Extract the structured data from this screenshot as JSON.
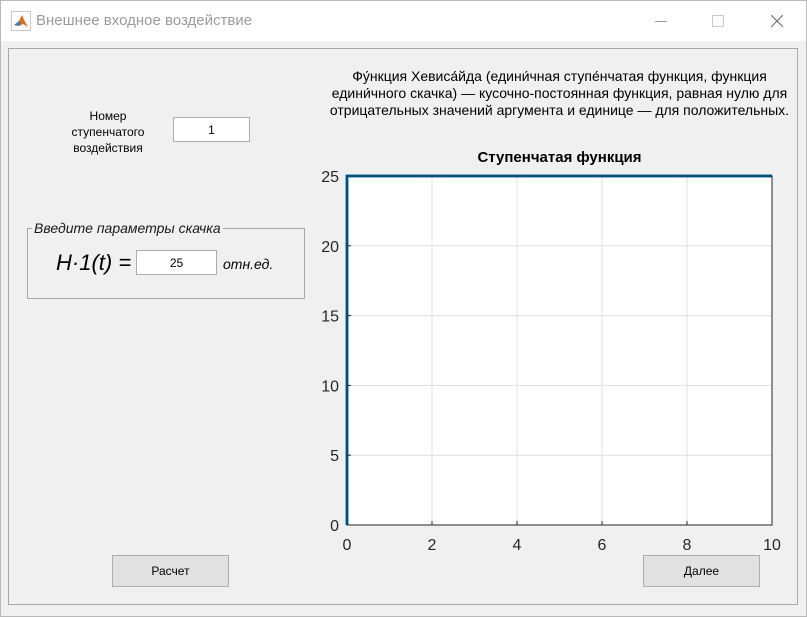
{
  "window": {
    "title": "Внешнее входное воздействие",
    "controls": [
      "minimize-icon",
      "maximize-icon",
      "close-icon"
    ]
  },
  "step_number": {
    "label": "Номер ступенчатого воздействия",
    "value": "1"
  },
  "jump_params": {
    "group_title": "Введите параметры скачка",
    "formula_label": "H·1(t) =",
    "value": "25",
    "unit": "отн.ед."
  },
  "description": "Фу́нкция Хевиса́йда (едини́чная ступе́нчатая функция, функция едини́чного скачка) — кусочно-постоянная функция, равная нулю для отрицательных значений аргумента и единице — для положительных.",
  "buttons": {
    "calculate": "Расчет",
    "next": "Далее"
  },
  "chart_data": {
    "type": "line",
    "title": "Ступенчатая функция",
    "xlabel": "",
    "ylabel": "",
    "xlim": [
      0,
      10
    ],
    "ylim": [
      0,
      25
    ],
    "xticks": [
      0,
      2,
      4,
      6,
      8,
      10
    ],
    "yticks": [
      0,
      5,
      10,
      15,
      20,
      25
    ],
    "grid": true,
    "series": [
      {
        "x": [
          0,
          0,
          10
        ],
        "y": [
          0,
          25,
          25
        ],
        "color": "#0072bd"
      }
    ]
  }
}
